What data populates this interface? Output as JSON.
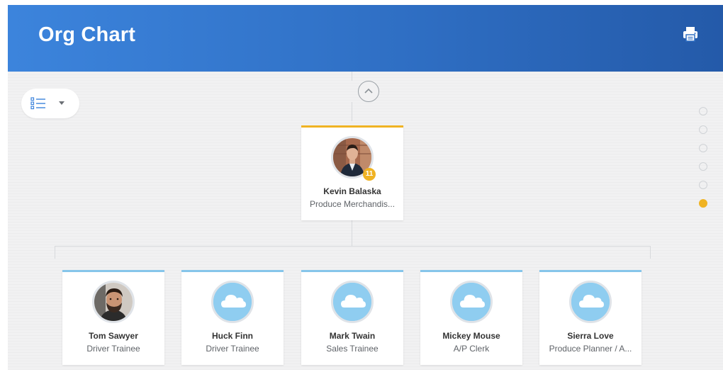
{
  "header": {
    "title": "Org Chart",
    "print_icon": "printer-icon"
  },
  "toolbar": {
    "view_icon": "list-view-icon",
    "dropdown_icon": "caret-down-icon"
  },
  "navigation": {
    "up_icon": "chevron-up-icon",
    "level_count": 6,
    "active_level": 6
  },
  "manager": {
    "name": "Kevin Balaska",
    "role": "Produce Merchandis...",
    "direct_reports_count": "11",
    "avatar": "photo"
  },
  "reports": [
    {
      "name": "Tom Sawyer",
      "role": "Driver Trainee",
      "avatar": "photo"
    },
    {
      "name": "Huck Finn",
      "role": "Driver Trainee",
      "avatar": "cloud-icon"
    },
    {
      "name": "Mark Twain",
      "role": "Sales Trainee",
      "avatar": "cloud-icon"
    },
    {
      "name": "Mickey Mouse",
      "role": "A/P Clerk",
      "avatar": "cloud-icon"
    },
    {
      "name": "Sierra Love",
      "role": "Produce Planner / A...",
      "avatar": "cloud-icon"
    }
  ],
  "colors": {
    "header": "#3c84dc",
    "manager_accent": "#f0b323",
    "report_accent": "#86c5ea",
    "cloud_avatar_bg": "#8fcdf0"
  }
}
